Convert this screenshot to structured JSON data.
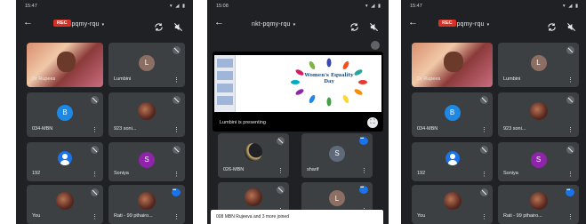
{
  "screens": [
    {
      "status": {
        "time": "15:47"
      },
      "meeting_code": "nkt-pqmy-rqu",
      "rec_label": "REC",
      "tiles": [
        {
          "name": "Dr Rupees",
          "kind": "photo"
        },
        {
          "name": "Lumbini",
          "kind": "letter",
          "letter": "L",
          "color": "#8d6e63"
        },
        {
          "name": "034-MBN",
          "kind": "letter",
          "letter": "B",
          "color": "#1e88e5"
        },
        {
          "name": "923 soni...",
          "kind": "thumb"
        },
        {
          "name": "192",
          "kind": "person"
        },
        {
          "name": "Soniya",
          "kind": "letter",
          "letter": "S",
          "color": "#8e24aa"
        },
        {
          "name": "You",
          "kind": "thumb"
        },
        {
          "name": "Rati - 99 pthairo...",
          "kind": "thumb"
        }
      ]
    },
    {
      "status": {
        "time": "15:08"
      },
      "meeting_code": "nkt-pqmy-rqu",
      "presentation": {
        "slide_title": "Women's Equality Day",
        "presenting_label": "Lumbini is presenting"
      },
      "tiles": [
        {
          "name": "026-MBN",
          "kind": "moon"
        },
        {
          "name": "sharif",
          "kind": "letter",
          "letter": "S",
          "color": "#5f6b7a"
        },
        {
          "name": "",
          "kind": "thumb"
        },
        {
          "name": "",
          "kind": "letter",
          "letter": "L",
          "color": "#8d6e63"
        }
      ],
      "toast": "008 MBN Rujeeva and 3 more joined"
    },
    {
      "status": {
        "time": "15:47"
      },
      "meeting_code": "nkt-pqmy-rqu",
      "rec_label": "REC",
      "tiles": [
        {
          "name": "Dr Rupees",
          "kind": "photo"
        },
        {
          "name": "Lumbini",
          "kind": "letter",
          "letter": "L",
          "color": "#8d6e63"
        },
        {
          "name": "034-MBN",
          "kind": "letter",
          "letter": "B",
          "color": "#1e88e5"
        },
        {
          "name": "923 soni...",
          "kind": "thumb"
        },
        {
          "name": "192",
          "kind": "person"
        },
        {
          "name": "Soniya",
          "kind": "letter",
          "letter": "S",
          "color": "#8e24aa"
        },
        {
          "name": "You",
          "kind": "thumb"
        },
        {
          "name": "Rati - 99 pthairo...",
          "kind": "thumb"
        }
      ]
    }
  ],
  "icons": {
    "back": "arrow-back-icon",
    "switch_camera": "camera-switch-icon",
    "audio_off": "volume-off-icon",
    "mute": "mic-off-icon",
    "speaking": "speaking-indicator-icon",
    "more": "more-vert-icon",
    "fullscreen": "fullscreen-icon"
  }
}
